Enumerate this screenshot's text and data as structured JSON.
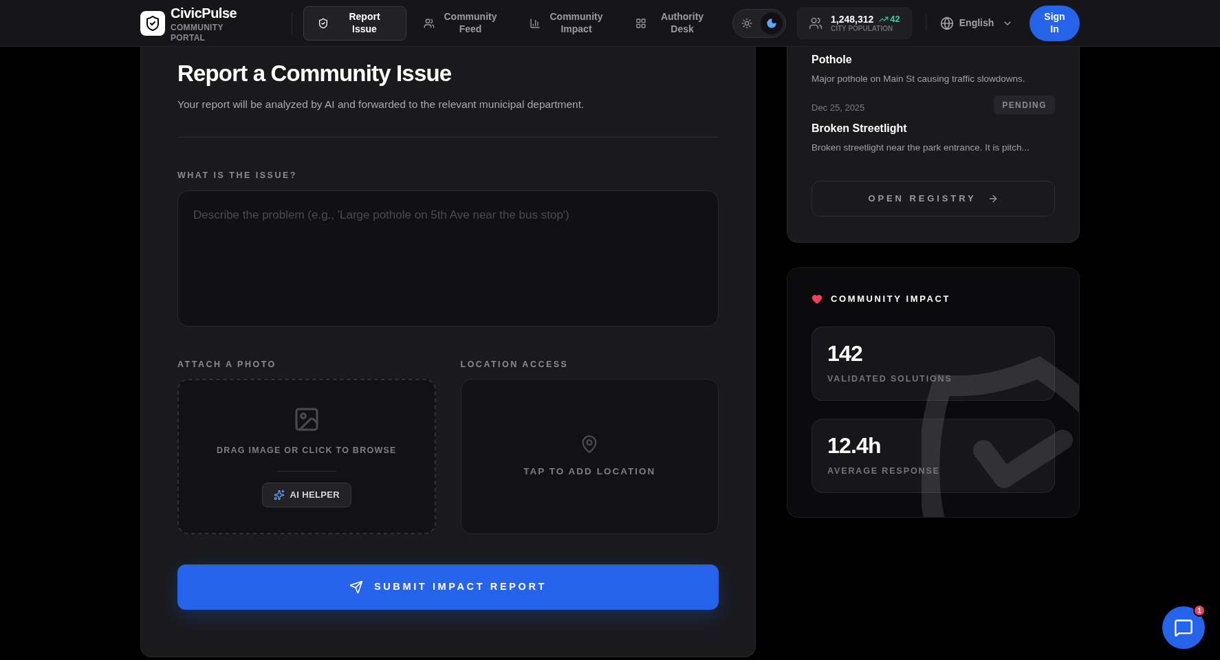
{
  "brand": {
    "name": "CivicPulse",
    "subtitle": "COMMUNITY PORTAL"
  },
  "nav": [
    {
      "label": "Report Issue",
      "selected": true
    },
    {
      "label": "Community Feed",
      "selected": false
    },
    {
      "label": "Community Impact",
      "selected": false
    },
    {
      "label": "Authority Desk",
      "selected": false
    }
  ],
  "theme_toggle": [
    {
      "kind": "light",
      "selected": false
    },
    {
      "kind": "dark",
      "selected": true
    }
  ],
  "population": {
    "value": "1,248,312",
    "change": "42",
    "label": "CITY POPULATION"
  },
  "language": "English",
  "sign_in": "Sign In",
  "report_form": {
    "title": "Report a Community Issue",
    "subtitle": "Your report will be analyzed by AI and forwarded to the relevant municipal department.",
    "issue_label": "WHAT IS THE ISSUE?",
    "issue_placeholder": "Describe the problem (e.g., 'Large pothole on 5th Ave near the bus stop')",
    "photo_label": "ATTACH A PHOTO",
    "photo_prompt": "DRAG IMAGE OR CLICK TO BROWSE",
    "ai_helper": "AI HELPER",
    "location_label": "LOCATION ACCESS",
    "location_prompt": "TAP TO ADD LOCATION",
    "submit": "SUBMIT IMPACT REPORT"
  },
  "registry": {
    "items": [
      {
        "title": "Pothole",
        "description": "Major pothole on Main St causing traffic slowdowns."
      },
      {
        "date": "Dec 25, 2025",
        "status": "PENDING",
        "title": "Broken Streetlight",
        "description": "Broken streetlight near the park entrance. It is pitch..."
      }
    ],
    "button": "OPEN REGISTRY"
  },
  "impact": {
    "title": "COMMUNITY IMPACT",
    "stats": [
      {
        "value": "142",
        "label": "VALIDATED SOLUTIONS"
      },
      {
        "value": "12.4h",
        "label": "AVERAGE RESPONSE"
      }
    ]
  },
  "chat": {
    "badge": "1"
  }
}
